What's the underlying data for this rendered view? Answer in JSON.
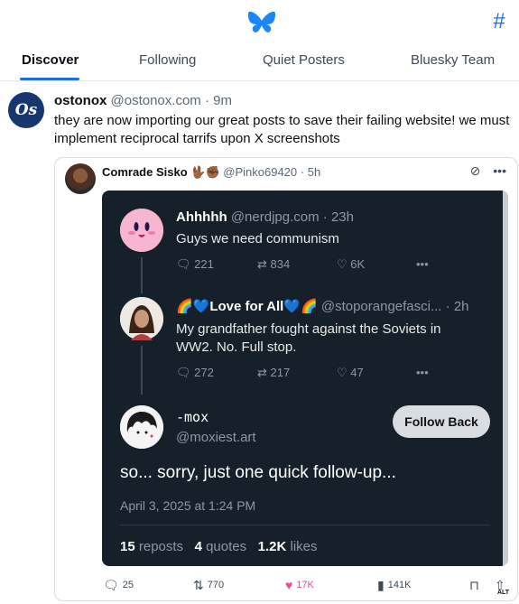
{
  "tabs": [
    "Discover",
    "Following",
    "Quiet Posters",
    "Bluesky Team"
  ],
  "post": {
    "avatar_text": "Os",
    "name": "ostonox",
    "handle": "@ostonox.com",
    "time": "9m",
    "text": "they are now importing our great posts to save their failing website! we must implement reciprocal tarrifs upon X screenshots"
  },
  "quote": {
    "name": "Comrade Sisko",
    "emoji": "🖖🏾✊🏾",
    "handle": "@Pinko69420",
    "time": "5h"
  },
  "screenshot": {
    "tweet1": {
      "name": "Ahhhhh",
      "handle": "@nerdjpg.com",
      "time": "23h",
      "text": "Guys we need communism",
      "replies": "221",
      "reposts": "834",
      "likes": "6K"
    },
    "tweet2": {
      "name": "🌈💙Love for All💙🌈",
      "handle": "@stoporangefasci...",
      "time": "2h",
      "text": "My grandfather fought against the Soviets in WW2. No. Full stop.",
      "replies": "272",
      "reposts": "217",
      "likes": "47"
    },
    "tweet3": {
      "name": "-mox",
      "handle": "@moxiest.art",
      "follow_label": "Follow Back",
      "text": "so... sorry, just one quick follow-up...",
      "date": "April 3, 2025 at 1:24 PM",
      "reposts_count": "15",
      "reposts_label": "reposts",
      "quotes_count": "4",
      "quotes_label": "quotes",
      "likes_count": "1.2K",
      "likes_label": "likes"
    }
  },
  "actions": {
    "replies": "25",
    "reposts": "770",
    "likes": "17K",
    "views": "141K",
    "alt_label": "ALT"
  },
  "colors": {
    "accent": "#1d6fe0",
    "like": "#ec4899",
    "dark_bg": "#15202b"
  }
}
